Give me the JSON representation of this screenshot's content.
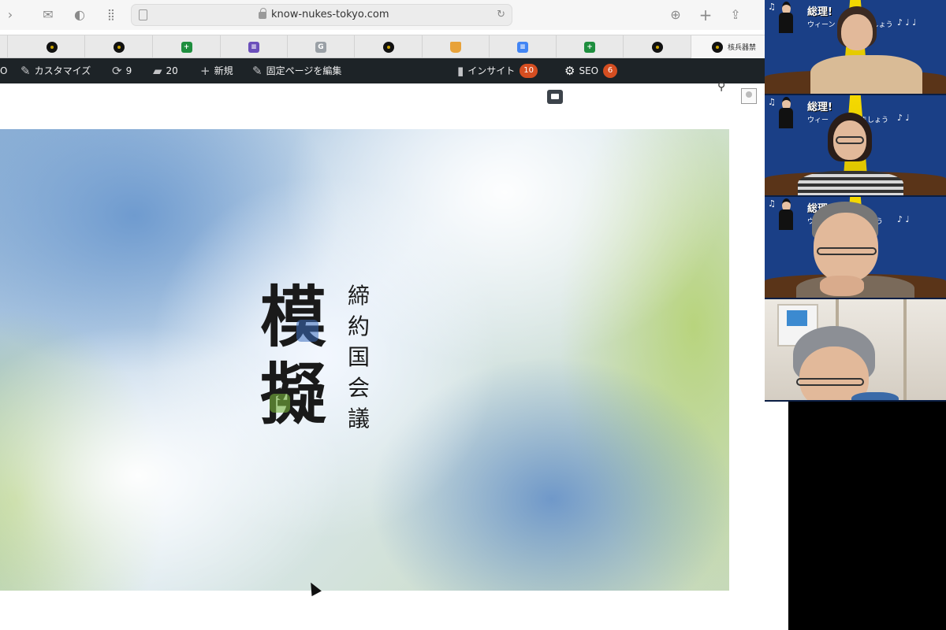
{
  "browser": {
    "url": "know-nukes-tokyo.com",
    "tabs": [
      {
        "icon": "pinterest-icon",
        "style": "red",
        "glyph": "P"
      },
      {
        "icon": "site-favicon-icon",
        "style": "dark",
        "glyph": ""
      },
      {
        "icon": "site-favicon-icon",
        "style": "dark",
        "glyph": ""
      },
      {
        "icon": "google-sheets-icon",
        "style": "green",
        "glyph": "+"
      },
      {
        "icon": "google-forms-icon",
        "style": "purple",
        "glyph": "≡"
      },
      {
        "icon": "g-favicon-icon",
        "style": "grey",
        "glyph": "G"
      },
      {
        "icon": "site-favicon-icon",
        "style": "dark",
        "glyph": ""
      },
      {
        "icon": "hat-favicon-icon",
        "style": "hat",
        "glyph": ""
      },
      {
        "icon": "google-docs-icon",
        "style": "blue",
        "glyph": "≡"
      },
      {
        "icon": "google-sheets-icon",
        "style": "green",
        "glyph": "+"
      },
      {
        "icon": "site-favicon-icon",
        "style": "dark",
        "glyph": ""
      }
    ],
    "active_tab_label": "核兵器禁"
  },
  "adminbar": {
    "left_fragment": "O",
    "customize": "カスタマイズ",
    "updates_count": "9",
    "comments_count": "20",
    "new": "新規",
    "edit_page": "固定ページを編集",
    "insight": "インサイト",
    "insight_count": "10",
    "seo": "SEO",
    "seo_count": "6"
  },
  "hero": {
    "logo_big": [
      "模",
      "擬"
    ],
    "logo_small": [
      "締",
      "約",
      "国",
      "会",
      "議"
    ]
  },
  "participants": [
    {
      "bg_title": "総理!",
      "bg_sub": "ウィーン",
      "bg_sub2": "しょう",
      "bg_notes": "♪ ♩ ♩"
    },
    {
      "bg_title": "総理!",
      "bg_sub": "ウィー",
      "bg_sub2": "ましょう",
      "bg_notes": "♪ ♩"
    },
    {
      "bg_title": "総理!",
      "bg_sub": "ウ",
      "bg_sub2": "しょう",
      "bg_notes": "♪ ♩"
    }
  ],
  "colors": {
    "wp_adminbar": "#1d2327",
    "count_badge": "#d54e21",
    "hero_blue": "#6896cd",
    "hero_green": "#b4d26e",
    "zoom_bg": "#1a3f86",
    "beam_yellow": "#f5d900"
  }
}
